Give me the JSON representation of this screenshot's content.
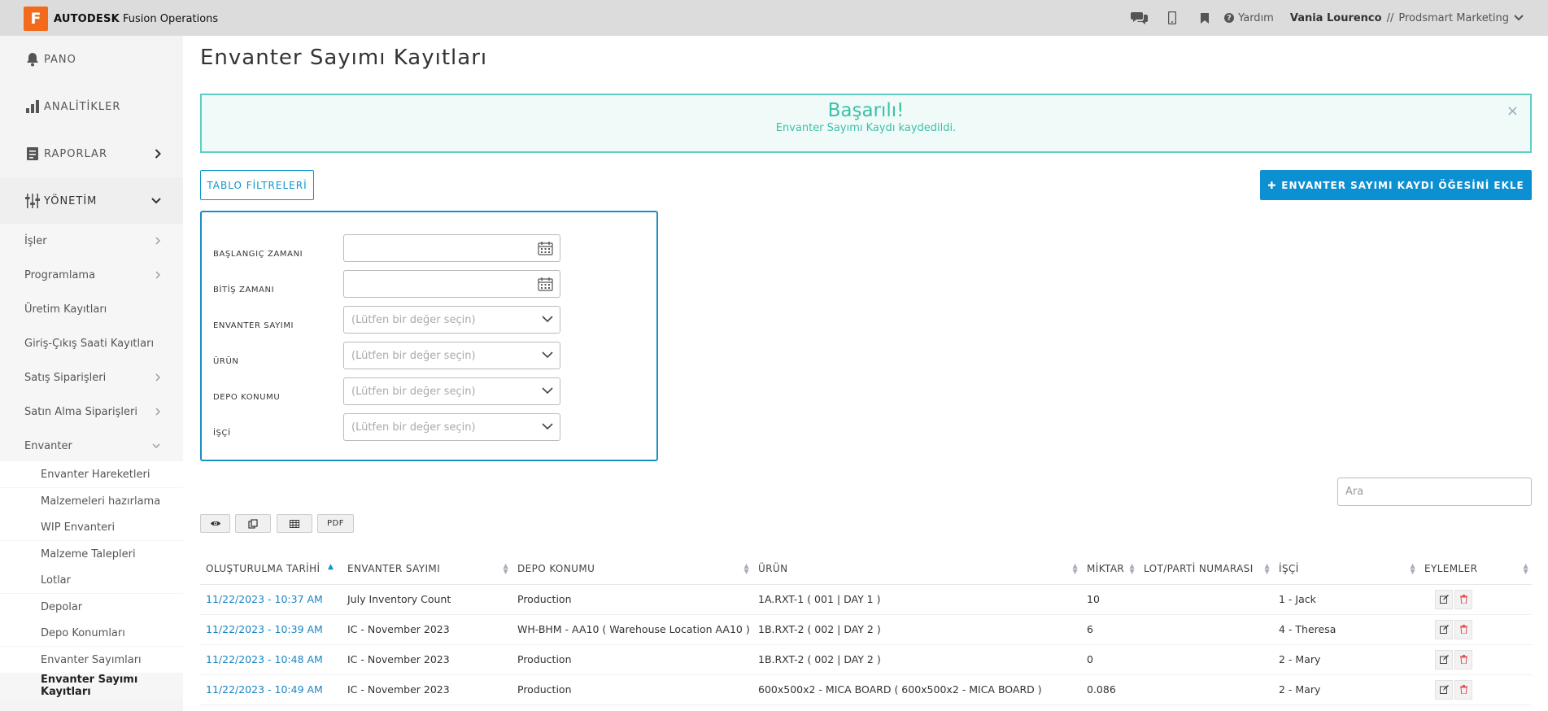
{
  "topbar": {
    "logo_letter": "F",
    "brand_bold": "AUTODESK",
    "brand_product": "Fusion Operations",
    "help_label": "Yardım",
    "user_name": "Vania Lourenco",
    "user_separator": "//",
    "company": "Prodsmart Marketing"
  },
  "sidebar": {
    "main": [
      {
        "label": "PANO",
        "icon": "bell-icon"
      },
      {
        "label": "ANALİTİKLER",
        "icon": "bar-chart-icon"
      },
      {
        "label": "RAPORLAR",
        "icon": "report-icon"
      },
      {
        "label": "YÖNETİM",
        "icon": "sliders-icon"
      }
    ],
    "management": [
      {
        "label": "İşler",
        "has_children": true
      },
      {
        "label": "Programlama",
        "has_children": true
      },
      {
        "label": "Üretim Kayıtları",
        "has_children": false
      },
      {
        "label": "Giriş-Çıkış Saati Kayıtları",
        "has_children": false
      },
      {
        "label": "Satış Siparişleri",
        "has_children": true
      },
      {
        "label": "Satın Alma Siparişleri",
        "has_children": true
      },
      {
        "label": "Envanter",
        "has_children": true
      }
    ],
    "inventory": [
      "Envanter Hareketleri",
      "Malzemeleri hazırlama",
      "WIP Envanteri",
      "Malzeme Talepleri",
      "Lotlar",
      "Depolar",
      "Depo Konumları",
      "Envanter Sayımları",
      "Envanter Sayımı Kayıtları"
    ]
  },
  "page": {
    "title": "Envanter Sayımı Kayıtları"
  },
  "alert": {
    "title": "Başarılı!",
    "message": "Envanter Sayımı Kaydı kaydedildi.",
    "close": "×"
  },
  "buttons": {
    "filters": "TABLO FİLTRELERİ",
    "add_plus": "✚",
    "add": "ENVANTER SAYIMI KAYDI ÖĞESİNİ EKLE"
  },
  "filters": {
    "start_label": "BAŞLANGIÇ ZAMANI",
    "end_label": "BİTİŞ ZAMANI",
    "count_label": "ENVANTER SAYIMI",
    "product_label": "ÜRÜN",
    "location_label": "DEPO KONUMU",
    "worker_label": "İŞÇİ",
    "select_placeholder": "(Lütfen bir değer seçin)"
  },
  "search": {
    "placeholder": "Ara"
  },
  "toolbar": {
    "pdf": "PDF"
  },
  "table": {
    "columns": [
      "OLUŞTURULMA TARİHİ",
      "ENVANTER SAYIMI",
      "DEPO KONUMU",
      "ÜRÜN",
      "MİKTAR",
      "LOT/PARTİ NUMARASI",
      "İŞÇİ",
      "EYLEMLER"
    ],
    "rows": [
      {
        "date": "11/22/2023 - 10:37 AM",
        "count": "July Inventory Count",
        "location": "Production",
        "product": "1A.RXT-1 ( 001 | DAY 1 )",
        "qty": "10",
        "lot": "",
        "worker": "1 - Jack"
      },
      {
        "date": "11/22/2023 - 10:39 AM",
        "count": "IC - November 2023",
        "location": "WH-BHM - AA10 ( Warehouse Location AA10 )",
        "product": "1B.RXT-2 ( 002 | DAY 2 )",
        "qty": "6",
        "lot": "",
        "worker": "4 - Theresa"
      },
      {
        "date": "11/22/2023 - 10:48 AM",
        "count": "IC - November 2023",
        "location": "Production",
        "product": "1B.RXT-2 ( 002 | DAY 2 )",
        "qty": "0",
        "lot": "",
        "worker": "2 - Mary"
      },
      {
        "date": "11/22/2023 - 10:49 AM",
        "count": "IC - November 2023",
        "location": "Production",
        "product": "600x500x2 - MICA BOARD ( 600x500x2 - MICA BOARD )",
        "qty": "0.086",
        "lot": "",
        "worker": "2 - Mary"
      }
    ]
  },
  "colors": {
    "accent": "#0d90d2",
    "success": "#3dbfa8",
    "logo": "#f26b1d",
    "delete": "#e05050"
  }
}
